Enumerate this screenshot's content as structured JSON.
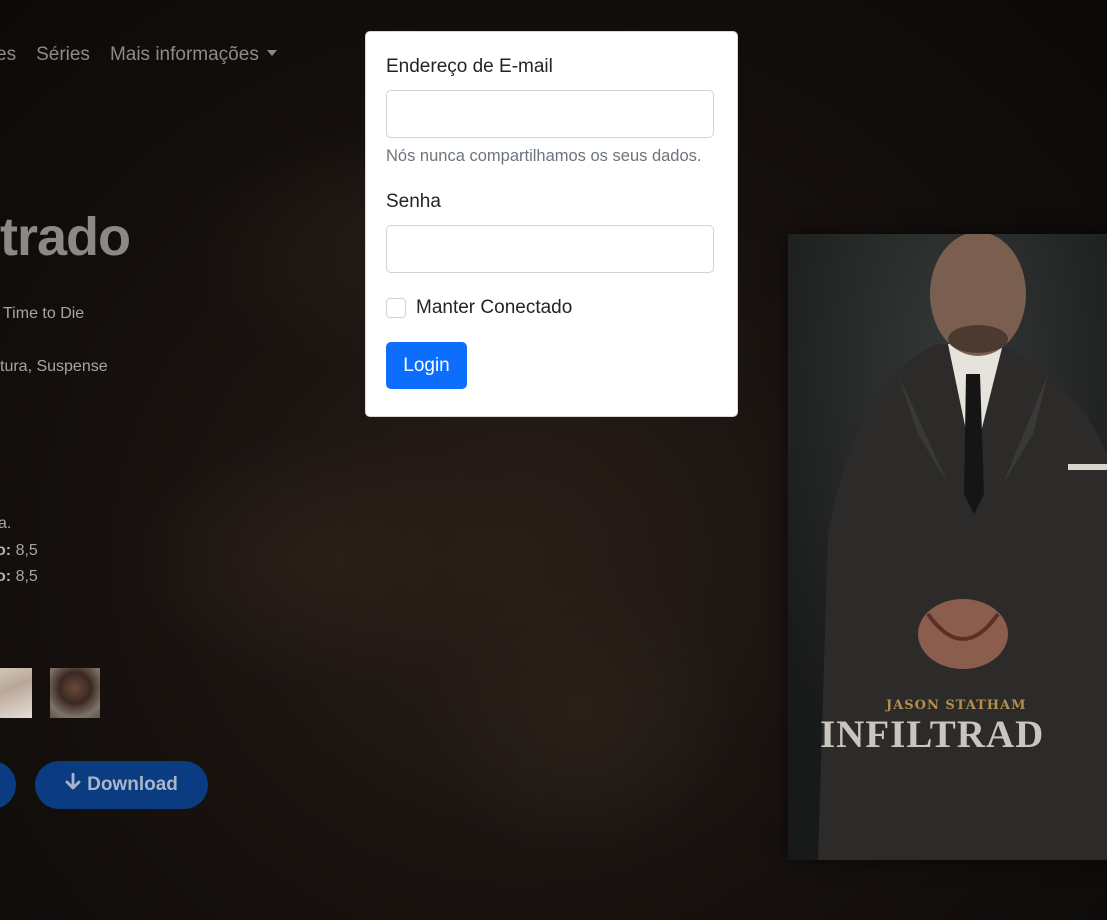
{
  "navbar": {
    "items": [
      "es",
      "Séries",
      "Mais informações"
    ]
  },
  "movie": {
    "title": "ltrado",
    "original_title": "Time to Die",
    "genres": "tura, Suspense",
    "line_a": "a.",
    "rating1_label": "o:",
    "rating1_value": "8,5",
    "rating2_label": "o:",
    "rating2_value": "8,5"
  },
  "buttons": {
    "download_label": "Download",
    "download_icon": "arrow-down-icon"
  },
  "poster": {
    "actor": "JASON STATHAM",
    "title": "INFILTRAD"
  },
  "login": {
    "email_label": "Endereço de E-mail",
    "email_value": "",
    "email_help": "Nós nunca compartilhamos os seus dados.",
    "password_label": "Senha",
    "password_value": "",
    "remember_label": "Manter Conectado",
    "remember_checked": false,
    "submit_label": "Login",
    "submit_color": "#0d6efd"
  }
}
